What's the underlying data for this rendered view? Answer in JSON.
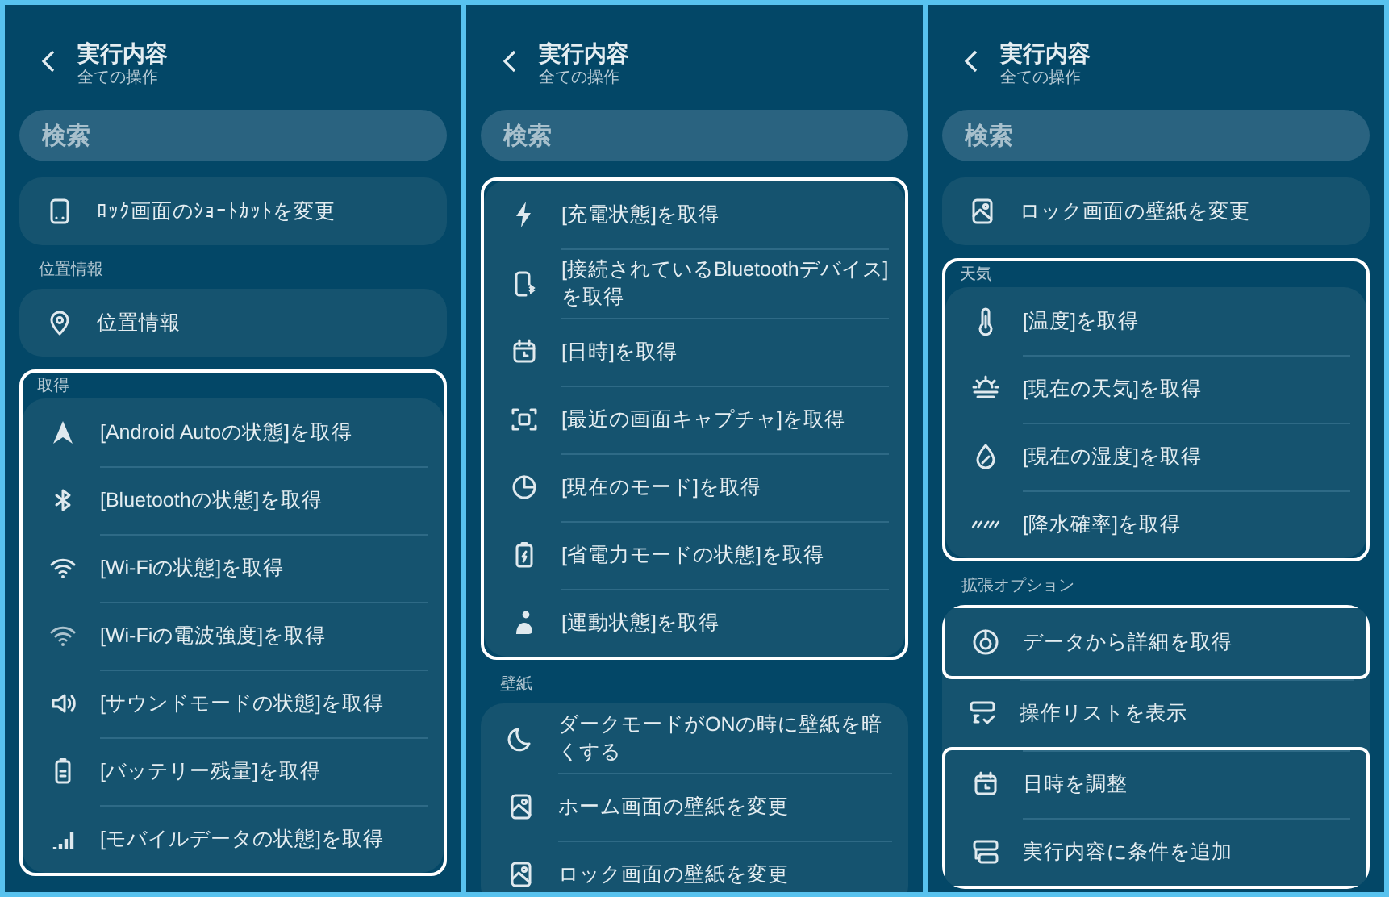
{
  "panels": [
    {
      "title": "実行内容",
      "subtitle": "全ての操作",
      "search": {
        "placeholder": "検索"
      },
      "groups": [
        {
          "highlighted": false,
          "items": [
            {
              "text": "ﾛｯｸ画面のｼｮｰﾄｶｯﾄを変更",
              "highlighted": false
            }
          ]
        },
        {
          "label": "位置情報",
          "highlighted": false,
          "items": [
            {
              "text": "位置情報",
              "highlighted": false
            }
          ]
        },
        {
          "label": "取得",
          "highlighted": true,
          "items": [
            {
              "text": "[Android Autoの状態]を取得",
              "highlighted": false
            },
            {
              "text": "[Bluetoothの状態]を取得",
              "highlighted": false
            },
            {
              "text": "[Wi-Fiの状態]を取得",
              "highlighted": false
            },
            {
              "text": "[Wi-Fiの電波強度]を取得",
              "highlighted": false
            },
            {
              "text": "[サウンドモードの状態]を取得",
              "highlighted": false
            },
            {
              "text": "[バッテリー残量]を取得",
              "highlighted": false
            },
            {
              "text": "[モバイルデータの状態]を取得",
              "highlighted": false
            }
          ]
        }
      ]
    },
    {
      "title": "実行内容",
      "subtitle": "全ての操作",
      "search": {
        "placeholder": "検索"
      },
      "groups": [
        {
          "highlighted": true,
          "items": [
            {
              "text": "[充電状態]を取得",
              "highlighted": false
            },
            {
              "text": "[接続されているBluetoothデバイス]を取得",
              "highlighted": false
            },
            {
              "text": "[日時]を取得",
              "highlighted": false
            },
            {
              "text": "[最近の画面キャプチャ]を取得",
              "highlighted": false
            },
            {
              "text": "[現在のモード]を取得",
              "highlighted": false
            },
            {
              "text": "[省電力モードの状態]を取得",
              "highlighted": false
            },
            {
              "text": "[運動状態]を取得",
              "highlighted": false
            }
          ]
        },
        {
          "label": "壁紙",
          "highlighted": false,
          "items": [
            {
              "text": "ダークモードがONの時に壁紙を暗くする",
              "highlighted": false
            },
            {
              "text": "ホーム画面の壁紙を変更",
              "highlighted": false
            },
            {
              "text": "ロック画面の壁紙を変更",
              "highlighted": false
            }
          ]
        }
      ]
    },
    {
      "title": "実行内容",
      "subtitle": "全ての操作",
      "search": {
        "placeholder": "検索"
      },
      "groups": [
        {
          "highlighted": false,
          "items": [
            {
              "text": "ロック画面の壁紙を変更",
              "highlighted": false
            }
          ]
        },
        {
          "label": "天気",
          "highlighted": true,
          "items": [
            {
              "text": "[温度]を取得",
              "highlighted": false
            },
            {
              "text": "[現在の天気]を取得",
              "highlighted": false
            },
            {
              "text": "[現在の湿度]を取得",
              "highlighted": false
            },
            {
              "text": "[降水確率]を取得",
              "highlighted": false
            }
          ]
        },
        {
          "label": "拡張オプション",
          "highlighted": false,
          "items": [
            {
              "text": "データから詳細を取得",
              "highlighted": true
            },
            {
              "text": "操作リストを表示",
              "highlighted": false
            },
            {
              "text": "日時を調整",
              "highlighted": true
            },
            {
              "text": "実行内容に条件を追加",
              "highlighted": true
            }
          ]
        }
      ]
    }
  ]
}
